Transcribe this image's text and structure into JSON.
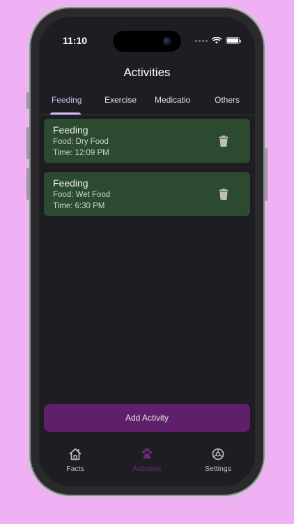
{
  "status_bar": {
    "time": "11:10"
  },
  "header": {
    "title": "Activities"
  },
  "tabs": [
    {
      "label": "Feeding",
      "active": true
    },
    {
      "label": "Exercise",
      "active": false
    },
    {
      "label": "Medication",
      "active": false
    },
    {
      "label": "Others",
      "active": false
    }
  ],
  "activities": [
    {
      "title": "Feeding",
      "food": "Food: Dry Food",
      "time": "Time: 12:09 PM"
    },
    {
      "title": "Feeding",
      "food": "Food: Wet Food",
      "time": "Time: 6:30 PM"
    }
  ],
  "add_button": {
    "label": "Add Activity"
  },
  "bottom_nav": [
    {
      "label": "Facts",
      "icon": "home-icon",
      "active": false
    },
    {
      "label": "Activities",
      "icon": "paw-icon",
      "active": true
    },
    {
      "label": "Settings",
      "icon": "gear-icon",
      "active": false
    }
  ],
  "colors": {
    "background": "#f0b0f4",
    "card": "#2b4a2f",
    "accent_tab": "#d3bcfd",
    "add_button": "#5f1f6a",
    "nav_active": "#6b2a78"
  }
}
